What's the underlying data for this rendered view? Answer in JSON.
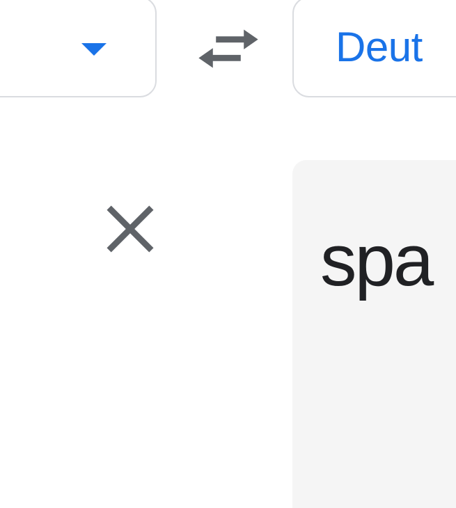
{
  "source_language": {
    "dropdown_visible": true
  },
  "target_language": {
    "label": "Deut"
  },
  "output": {
    "text": "spa"
  },
  "colors": {
    "accent_blue": "#1a73e8",
    "border_gray": "#dadce0",
    "icon_gray": "#5f6368",
    "panel_gray": "#f5f5f5",
    "text_dark": "#202124"
  }
}
